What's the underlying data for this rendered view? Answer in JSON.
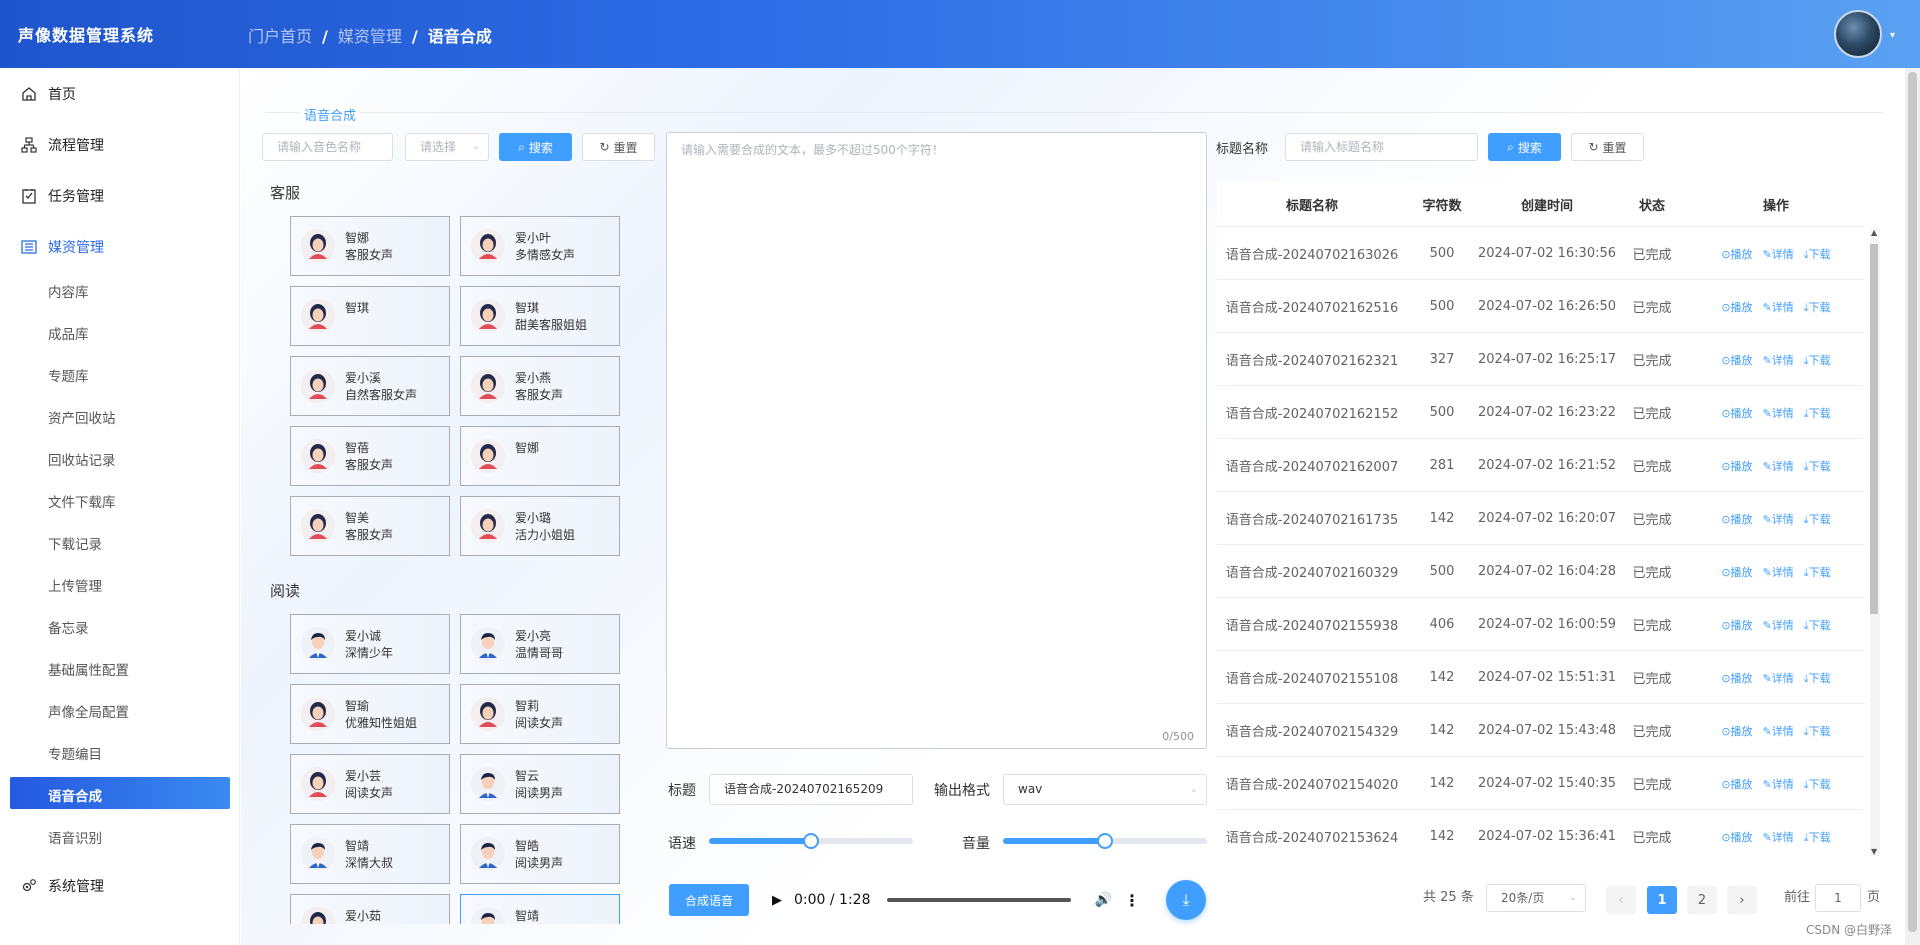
{
  "app": {
    "title": "声像数据管理系统"
  },
  "breadcrumb": [
    "门户首页",
    "媒资管理",
    "语音合成"
  ],
  "sidebar": {
    "items": [
      {
        "label": "首页",
        "icon": "home-icon"
      },
      {
        "label": "流程管理",
        "icon": "flow-icon"
      },
      {
        "label": "任务管理",
        "icon": "task-icon"
      },
      {
        "label": "媒资管理",
        "icon": "media-icon"
      }
    ],
    "subitems": [
      "内容库",
      "成品库",
      "专题库",
      "资产回收站",
      "回收站记录",
      "文件下载库",
      "下载记录",
      "上传管理",
      "备忘录",
      "基础属性配置",
      "声像全局配置",
      "专题编目",
      "语音合成",
      "语音识别"
    ],
    "system": {
      "label": "系统管理",
      "icon": "gear-icon"
    }
  },
  "section": {
    "title": "语音合成"
  },
  "voice_search": {
    "placeholder": "请输入音色名称",
    "select_placeholder": "请选择",
    "search_label": "搜索",
    "reset_label": "重置"
  },
  "voice_groups": [
    {
      "title": "客服",
      "voices": [
        {
          "name": "智娜",
          "desc": "客服女声",
          "gender": "f"
        },
        {
          "name": "爱小叶",
          "desc": "多情感女声",
          "gender": "f"
        },
        {
          "name": "智琪",
          "desc": "",
          "gender": "f"
        },
        {
          "name": "智琪",
          "desc": "甜美客服姐姐",
          "gender": "f"
        },
        {
          "name": "爱小溪",
          "desc": "自然客服女声",
          "gender": "f"
        },
        {
          "name": "爱小燕",
          "desc": "客服女声",
          "gender": "f"
        },
        {
          "name": "智蓓",
          "desc": "客服女声",
          "gender": "f"
        },
        {
          "name": "智娜",
          "desc": "",
          "gender": "f"
        },
        {
          "name": "智美",
          "desc": "客服女声",
          "gender": "f"
        },
        {
          "name": "爱小璐",
          "desc": "活力小姐姐",
          "gender": "f"
        }
      ]
    },
    {
      "title": "阅读",
      "voices": [
        {
          "name": "爱小诚",
          "desc": "深情少年",
          "gender": "m"
        },
        {
          "name": "爱小亮",
          "desc": "温情哥哥",
          "gender": "m"
        },
        {
          "name": "智瑜",
          "desc": "优雅知性姐姐",
          "gender": "f"
        },
        {
          "name": "智莉",
          "desc": "阅读女声",
          "gender": "f"
        },
        {
          "name": "爱小芸",
          "desc": "阅读女声",
          "gender": "f"
        },
        {
          "name": "智云",
          "desc": "阅读男声",
          "gender": "m"
        },
        {
          "name": "智靖",
          "desc": "深情大叔",
          "gender": "m"
        },
        {
          "name": "智皓",
          "desc": "阅读男声",
          "gender": "m"
        },
        {
          "name": "爱小茹",
          "desc": "",
          "gender": "f"
        },
        {
          "name": "智靖",
          "desc": "",
          "gender": "m"
        }
      ]
    }
  ],
  "editor": {
    "placeholder": "请输入需要合成的文本，最多不超过500个字符！",
    "counter": "0/500"
  },
  "form": {
    "title_label": "标题",
    "title_value": "语音合成-20240702165209",
    "format_label": "输出格式",
    "format_value": "wav",
    "speed_label": "语速",
    "speed_value": 0.5,
    "volume_label": "音量",
    "volume_value": 0.5,
    "synth_label": "合成语音"
  },
  "audio": {
    "time": "0:00 / 1:28",
    "progress": 0
  },
  "table_filter": {
    "label": "标题名称",
    "placeholder": "请输入标题名称",
    "search_label": "搜索",
    "reset_label": "重置"
  },
  "table": {
    "columns": [
      "标题名称",
      "字符数",
      "创建时间",
      "状态",
      "操作"
    ],
    "actions": {
      "play": "播放",
      "detail": "详情",
      "download": "下载"
    },
    "rows": [
      [
        "语音合成-20240702163026",
        "500",
        "2024-07-02 16:30:56",
        "已完成"
      ],
      [
        "语音合成-20240702162516",
        "500",
        "2024-07-02 16:26:50",
        "已完成"
      ],
      [
        "语音合成-20240702162321",
        "327",
        "2024-07-02 16:25:17",
        "已完成"
      ],
      [
        "语音合成-20240702162152",
        "500",
        "2024-07-02 16:23:22",
        "已完成"
      ],
      [
        "语音合成-20240702162007",
        "281",
        "2024-07-02 16:21:52",
        "已完成"
      ],
      [
        "语音合成-20240702161735",
        "142",
        "2024-07-02 16:20:07",
        "已完成"
      ],
      [
        "语音合成-20240702160329",
        "500",
        "2024-07-02 16:04:28",
        "已完成"
      ],
      [
        "语音合成-20240702155938",
        "406",
        "2024-07-02 16:00:59",
        "已完成"
      ],
      [
        "语音合成-20240702155108",
        "142",
        "2024-07-02 15:51:31",
        "已完成"
      ],
      [
        "语音合成-20240702154329",
        "142",
        "2024-07-02 15:43:48",
        "已完成"
      ],
      [
        "语音合成-20240702154020",
        "142",
        "2024-07-02 15:40:35",
        "已完成"
      ],
      [
        "语音合成-20240702153624",
        "142",
        "2024-07-02 15:36:41",
        "已完成"
      ]
    ]
  },
  "pagination": {
    "total": "共 25 条",
    "size": "20条/页",
    "pages": [
      "1",
      "2"
    ],
    "goto_label": "前往",
    "goto_value": "1",
    "goto_suffix": "页"
  },
  "watermark": "CSDN @白野泽",
  "colors": {
    "primary": "#409eff",
    "header_start": "#1f55cc",
    "active_menu": "#2459e0"
  }
}
